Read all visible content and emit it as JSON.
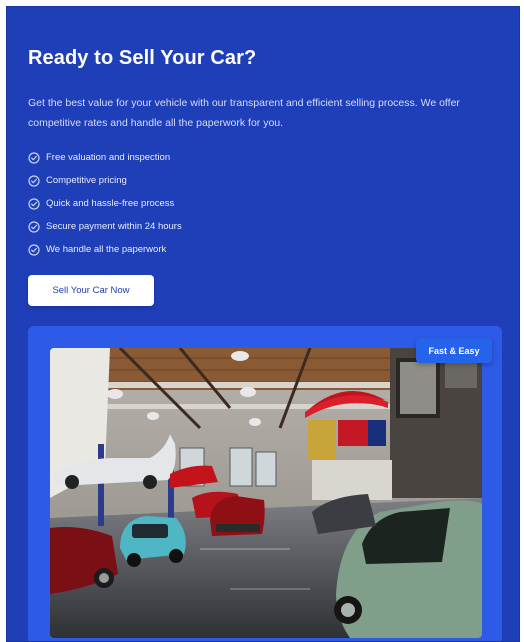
{
  "hero": {
    "title": "Ready to Sell Your Car?",
    "description": "Get the best value for your vehicle with our transparent and efficient selling process. We offer competitive rates and handle all the paperwork for you.",
    "features": [
      "Free valuation and inspection",
      "Competitive pricing",
      "Quick and hassle-free process",
      "Secure payment within 24 hours",
      "We handle all the paperwork"
    ],
    "cta_label": "Sell Your Car Now"
  },
  "image_panel": {
    "badge": "Fast & Easy",
    "image_subject": "classic-car-garage-photo"
  },
  "colors": {
    "background": "#1e3fb8",
    "panel": "#2d5ae6",
    "badge": "#2563eb",
    "cta_text": "#1e3fb8",
    "text": "#ffffff"
  },
  "icons": {
    "feature": "check-circle-icon"
  }
}
